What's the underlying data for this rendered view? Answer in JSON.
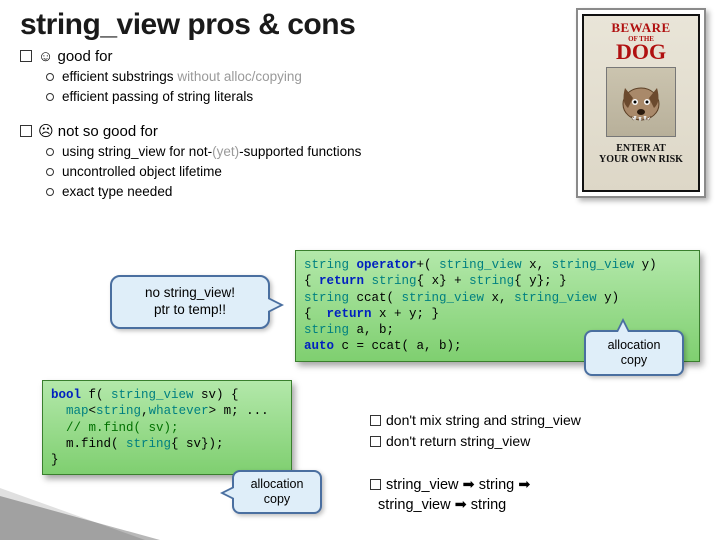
{
  "title": "string_view pros & cons",
  "poster": {
    "beware": "BEWARE",
    "ofthe": "OF THE",
    "dog": "DOG",
    "enter": "ENTER AT\nYOUR OWN RISK"
  },
  "good": {
    "heading": "☺ good for",
    "item1a": "efficient substrings",
    "item1b": " without alloc/copying",
    "item2": "efficient passing of string literals"
  },
  "bad": {
    "heading": "☹ not so good for",
    "item1a": "using string_view for not-",
    "item1b": "(yet)",
    "item1c": "-supported functions",
    "item2": "uncontrolled object lifetime",
    "item3": "exact type needed"
  },
  "callout1": "no string_view!\nptr to temp!!",
  "alloc1": "allocation\ncopy",
  "alloc2": "allocation\ncopy",
  "code1": "string operator+( string_view x, string_view y)\n{ return string{ x} + string{ y}; }\nstring ccat( string_view x, string_view y)\n{  return x + y; }\nstring a, b;\nauto c = ccat( a, b);",
  "code2": "bool f( string_view sv) {\n  map<string,whatever> m; ...\n  // m.find( sv);\n  m.find( string{ sv});\n}",
  "tips": {
    "t1": "don't mix string and string_view",
    "t2": "don't return string_view"
  },
  "chain": "string_view ➡ string ➡\n  string_view ➡ string"
}
